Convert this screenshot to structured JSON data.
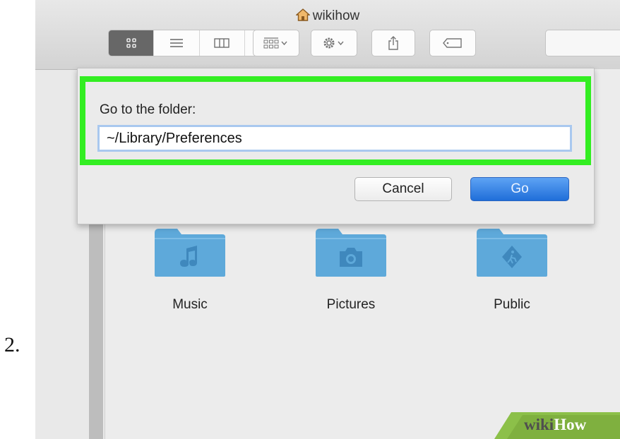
{
  "step": {
    "number": "2."
  },
  "window": {
    "title": "wikihow"
  },
  "dialog": {
    "prompt": "Go to the folder:",
    "path_value": "~/Library/Preferences",
    "cancel_label": "Cancel",
    "go_label": "Go"
  },
  "folders": [
    {
      "label": "Music",
      "icon": "music-note-icon"
    },
    {
      "label": "Pictures",
      "icon": "camera-icon"
    },
    {
      "label": "Public",
      "icon": "public-sign-icon"
    }
  ],
  "watermark": {
    "text_a": "wiki",
    "text_b": "How"
  },
  "colors": {
    "highlight": "#33ee22",
    "folder_blue": "#5ea9da",
    "go_button": "#2a74de",
    "watermark_green": "#8cc049"
  }
}
